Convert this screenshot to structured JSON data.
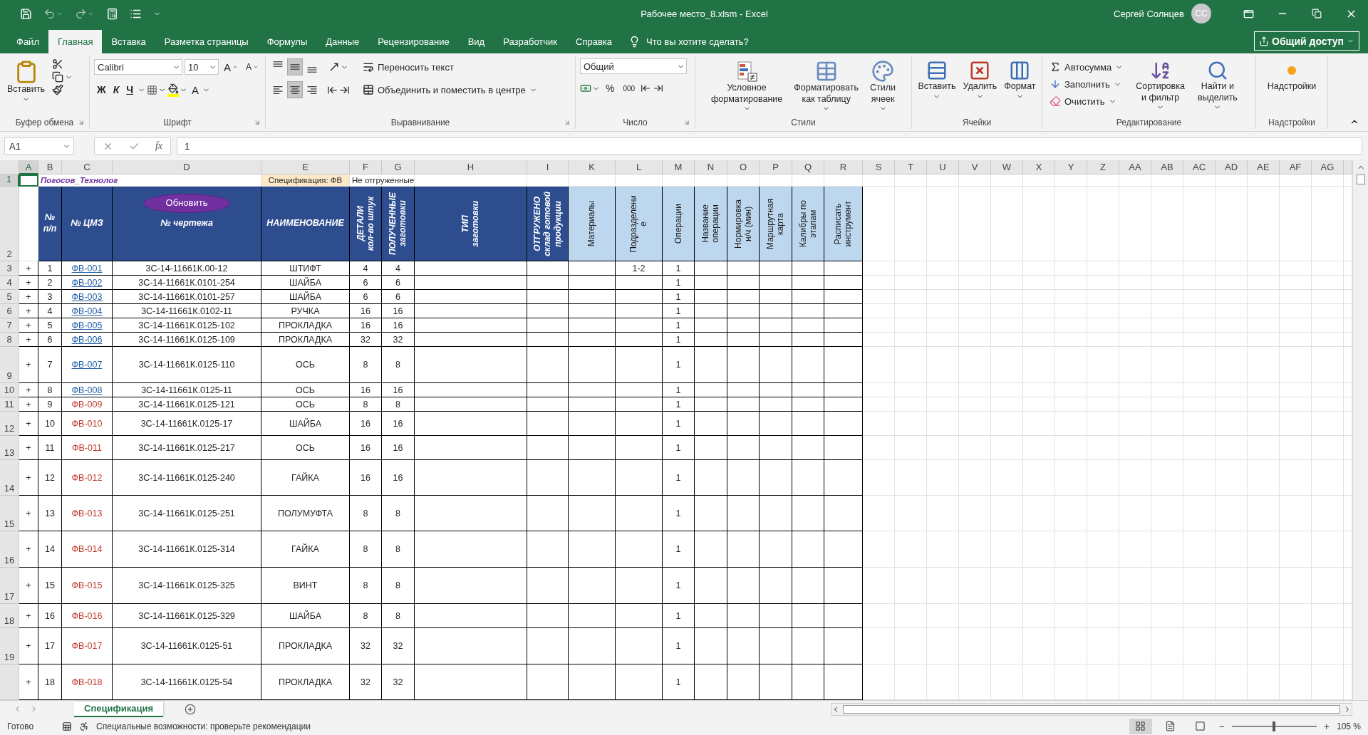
{
  "title_bar": {
    "title": "Рабочее место_8.xlsm  -  Excel",
    "user": "Сергей Солнцев",
    "initials": "CC"
  },
  "menu_tabs": [
    {
      "label": "Файл",
      "selected": false
    },
    {
      "label": "Главная",
      "selected": true
    },
    {
      "label": "Вставка",
      "selected": false
    },
    {
      "label": "Разметка страницы",
      "selected": false
    },
    {
      "label": "Формулы",
      "selected": false
    },
    {
      "label": "Данные",
      "selected": false
    },
    {
      "label": "Рецензирование",
      "selected": false
    },
    {
      "label": "Вид",
      "selected": false
    },
    {
      "label": "Разработчик",
      "selected": false
    },
    {
      "label": "Справка",
      "selected": false
    }
  ],
  "tell_me": "Что вы хотите сделать?",
  "share": "Общий доступ",
  "ribbon": {
    "clipboard": {
      "paste": "Вставить",
      "label": "Буфер обмена"
    },
    "font": {
      "font_name": "Calibri",
      "font_size": "10",
      "grow": "A",
      "shrink": "A",
      "bold": "Ж",
      "italic": "К",
      "underline": "Ч",
      "font_color": "A",
      "label": "Шрифт"
    },
    "alignment": {
      "vertical": [
        {
          "selected": false
        },
        {
          "selected": true
        },
        {
          "selected": false
        }
      ],
      "horizontal": [
        {
          "selected": false
        },
        {
          "selected": true
        },
        {
          "selected": false
        }
      ],
      "wrap": "Переносить текст",
      "merge": "Объединить и поместить в центре",
      "label": "Выравнивание"
    },
    "number": {
      "format": "Общий",
      "percent": "%",
      "thousands": "000",
      "label": "Число"
    },
    "styles": {
      "conditional": "Условное\nформатирование",
      "as_table": "Форматировать\nкак таблицу",
      "cell_styles": "Стили\nячеек",
      "label": "Стили"
    },
    "cells": {
      "insert": "Вставить",
      "delete": "Удалить",
      "format": "Формат",
      "label": "Ячейки"
    },
    "editing": {
      "autosum": "Автосумма",
      "fill": "Заполнить",
      "clear": "Очистить",
      "sort": "Сортировка\nи фильтр",
      "find": "Найти и\nвыделить",
      "label": "Редактирование"
    },
    "addins": {
      "button": "Надстройки",
      "label": "Надстройки"
    }
  },
  "formula_bar": {
    "name_box": "A1",
    "fx": "fx",
    "value": "1"
  },
  "columns": [
    {
      "label": "A",
      "selected": true
    },
    {
      "label": "B",
      "selected": false
    },
    {
      "label": "C",
      "selected": false
    },
    {
      "label": "D",
      "selected": false
    },
    {
      "label": "E",
      "selected": false
    },
    {
      "label": "F",
      "selected": false
    },
    {
      "label": "G",
      "selected": false
    },
    {
      "label": "H",
      "selected": false
    },
    {
      "label": "I",
      "selected": false
    },
    {
      "label": "K",
      "selected": false
    },
    {
      "label": "L",
      "selected": false
    },
    {
      "label": "M",
      "selected": false
    },
    {
      "label": "N",
      "selected": false
    },
    {
      "label": "O",
      "selected": false
    },
    {
      "label": "P",
      "selected": false
    },
    {
      "label": "Q",
      "selected": false
    },
    {
      "label": "R",
      "selected": false
    },
    {
      "label": "S",
      "selected": false
    },
    {
      "label": "T",
      "selected": false
    },
    {
      "label": "U",
      "selected": false
    },
    {
      "label": "V",
      "selected": false
    },
    {
      "label": "W",
      "selected": false
    },
    {
      "label": "X",
      "selected": false
    },
    {
      "label": "Y",
      "selected": false
    },
    {
      "label": "Z",
      "selected": false
    },
    {
      "label": "AA",
      "selected": false
    },
    {
      "label": "AB",
      "selected": false
    },
    {
      "label": "AC",
      "selected": false
    },
    {
      "label": "AD",
      "selected": false
    },
    {
      "label": "AE",
      "selected": false
    },
    {
      "label": "AF",
      "selected": false
    },
    {
      "label": "AG",
      "selected": false
    }
  ],
  "row1": {
    "row": "1",
    "selected": true,
    "author": "Погосов_Технолог",
    "spec": "Спецификация: ФВ",
    "filter": "Не отгруженные"
  },
  "header": {
    "row": "2",
    "cells": [
      {
        "kind": "dark",
        "text": "№\nп/п"
      },
      {
        "kind": "dark",
        "text": "№ ЦМЗ"
      },
      {
        "kind": "dark",
        "text": "№ чертежа",
        "button": "Обновить"
      },
      {
        "kind": "dark",
        "text": "НАИМЕНОВАНИЕ"
      },
      {
        "kind": "dark-vertical",
        "text": "ДЕТАЛИ\nкол-во штук"
      },
      {
        "kind": "dark-vertical",
        "text": "ПОЛУЧЕННЫЕ\nзаготовки"
      },
      {
        "kind": "dark-vertical",
        "text": "ТИП\nзаготовки"
      },
      {
        "kind": "dark-vertical",
        "text": "ОТГРУЖЕНО\nсклад готовой\nпродукции"
      },
      {
        "kind": "light-vertical",
        "text": "Материалы"
      },
      {
        "kind": "light-vertical",
        "text": "Подразделени\nе"
      },
      {
        "kind": "light-vertical",
        "text": "Операции"
      },
      {
        "kind": "light-vertical",
        "text": "Название\nоперации"
      },
      {
        "kind": "light-vertical",
        "text": "Нормировка\nн/ч (мин)"
      },
      {
        "kind": "light-vertical",
        "text": "Маршрутная\nкарта"
      },
      {
        "kind": "light-vertical",
        "text": "Калибры по\nэтапам"
      },
      {
        "kind": "light-vertical",
        "text": "Расписать\nинструмент"
      }
    ]
  },
  "rows": [
    {
      "row": "3",
      "plus": "+",
      "pn": "1",
      "code": "ФВ-001",
      "linked": true,
      "drawing": "3С-14-11661К.00-12",
      "name": "ШТИФТ",
      "qty": "4",
      "received": "4",
      "division": "1-2",
      "ops": "1"
    },
    {
      "row": "4",
      "plus": "+",
      "pn": "2",
      "code": "ФВ-002",
      "linked": true,
      "drawing": "3С-14-11661К.0101-254",
      "name": "ШАЙБА",
      "qty": "6",
      "received": "6",
      "ops": "1"
    },
    {
      "row": "5",
      "plus": "+",
      "pn": "3",
      "code": "ФВ-003",
      "linked": true,
      "drawing": "3С-14-11661К.0101-257",
      "name": "ШАЙБА",
      "qty": "6",
      "received": "6",
      "ops": "1"
    },
    {
      "row": "6",
      "plus": "+",
      "pn": "4",
      "code": "ФВ-004",
      "linked": true,
      "drawing": "3С-14-11661К.0102-11",
      "name": "РУЧКА",
      "qty": "16",
      "received": "16",
      "ops": "1"
    },
    {
      "row": "7",
      "plus": "+",
      "pn": "5",
      "code": "ФВ-005",
      "linked": true,
      "drawing": "3С-14-11661К.0125-102",
      "name": "ПРОКЛАДКА",
      "qty": "16",
      "received": "16",
      "ops": "1"
    },
    {
      "row": "8",
      "plus": "+",
      "pn": "6",
      "code": "ФВ-006",
      "linked": true,
      "drawing": "3С-14-11661К.0125-109",
      "name": "ПРОКЛАДКА",
      "qty": "32",
      "received": "32",
      "ops": "1"
    },
    {
      "row": "9",
      "plus": "+",
      "pn": "7",
      "code": "ФВ-007",
      "linked": true,
      "drawing": "3С-14-11661К.0125-110",
      "name": "ОСЬ",
      "qty": "8",
      "received": "8",
      "ops": "1"
    },
    {
      "row": "10",
      "plus": "+",
      "pn": "8",
      "code": "ФВ-008",
      "linked": true,
      "drawing": "3С-14-11661К.0125-11",
      "name": "ОСЬ",
      "qty": "16",
      "received": "16",
      "ops": "1"
    },
    {
      "row": "11",
      "plus": "+",
      "pn": "9",
      "code": "ФВ-009",
      "linked": false,
      "drawing": "3С-14-11661К.0125-121",
      "name": "ОСЬ",
      "qty": "8",
      "received": "8",
      "ops": "1"
    },
    {
      "row": "12",
      "plus": "+",
      "pn": "10",
      "code": "ФВ-010",
      "linked": false,
      "drawing": "3С-14-11661К.0125-17",
      "name": "ШАЙБА",
      "qty": "16",
      "received": "16",
      "ops": "1"
    },
    {
      "row": "13",
      "plus": "+",
      "pn": "11",
      "code": "ФВ-011",
      "linked": false,
      "drawing": "3С-14-11661К.0125-217",
      "name": "ОСЬ",
      "qty": "16",
      "received": "16",
      "ops": "1"
    },
    {
      "row": "14",
      "plus": "+",
      "pn": "12",
      "code": "ФВ-012",
      "linked": false,
      "drawing": "3С-14-11661К.0125-240",
      "name": "ГАЙКА",
      "qty": "16",
      "received": "16",
      "ops": "1"
    },
    {
      "row": "15",
      "plus": "+",
      "pn": "13",
      "code": "ФВ-013",
      "linked": false,
      "drawing": "3С-14-11661К.0125-251",
      "name": "ПОЛУМУФТА",
      "qty": "8",
      "received": "8",
      "ops": "1"
    },
    {
      "row": "16",
      "plus": "+",
      "pn": "14",
      "code": "ФВ-014",
      "linked": false,
      "drawing": "3С-14-11661К.0125-314",
      "name": "ГАЙКА",
      "qty": "8",
      "received": "8",
      "ops": "1"
    },
    {
      "row": "17",
      "plus": "+",
      "pn": "15",
      "code": "ФВ-015",
      "linked": false,
      "drawing": "3С-14-11661К.0125-325",
      "name": "ВИНТ",
      "qty": "8",
      "received": "8",
      "ops": "1"
    },
    {
      "row": "18",
      "plus": "+",
      "pn": "16",
      "code": "ФВ-016",
      "linked": false,
      "drawing": "3С-14-11661К.0125-329",
      "name": "ШАЙБА",
      "qty": "8",
      "received": "8",
      "ops": "1"
    },
    {
      "row": "19",
      "plus": "+",
      "pn": "17",
      "code": "ФВ-017",
      "linked": false,
      "drawing": "3С-14-11661К.0125-51",
      "name": "ПРОКЛАДКА",
      "qty": "32",
      "received": "32",
      "ops": "1"
    },
    {
      "plus": "+",
      "pn": "18",
      "code": "ФВ-018",
      "linked": false,
      "drawing": "3С-14-11661К.0125-54",
      "name": "ПРОКЛАДКА",
      "qty": "32",
      "received": "32",
      "ops": "1"
    }
  ],
  "sheet_tabs": [
    {
      "label": "Спецификация",
      "selected": true
    }
  ],
  "status": {
    "ready": "Готово",
    "accessibility": "Специальные возможности: проверьте рекомендации",
    "views": [
      {
        "selected": true
      },
      {
        "selected": false
      },
      {
        "selected": false
      }
    ],
    "minus": "−",
    "plus": "+",
    "zoom": {
      "level": 0.5,
      "reading": "105 %"
    }
  }
}
